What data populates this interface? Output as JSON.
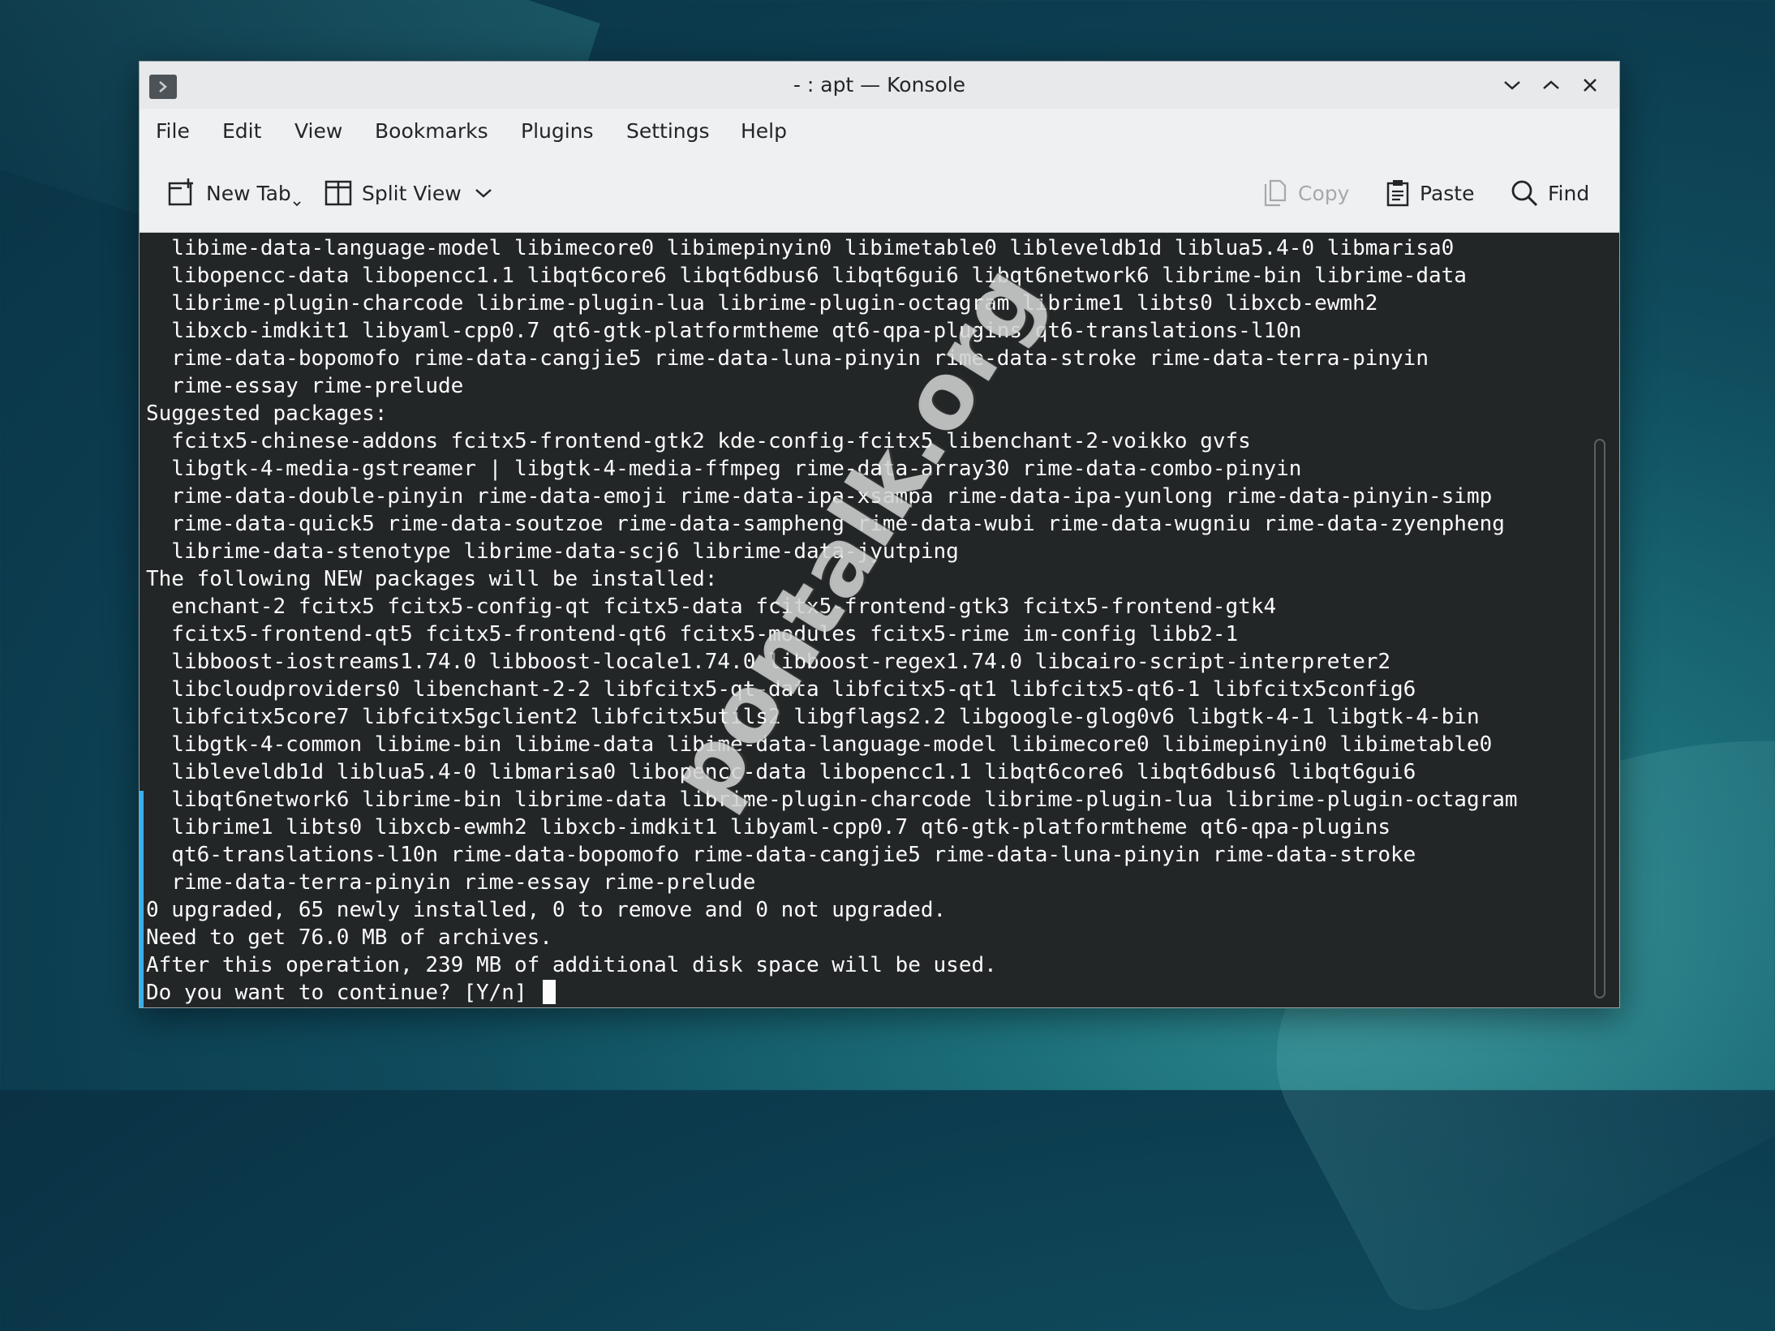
{
  "window": {
    "title": "- : apt — Konsole"
  },
  "menu": [
    "File",
    "Edit",
    "View",
    "Bookmarks",
    "Plugins",
    "Settings",
    "Help"
  ],
  "toolbar": {
    "new_tab": "New Tab",
    "split_view": "Split View",
    "copy": "Copy",
    "paste": "Paste",
    "find": "Find"
  },
  "terminal": {
    "lines": [
      "  libime-data-language-model libimecore0 libimepinyin0 libimetable0 libleveldb1d liblua5.4-0 libmarisa0",
      "  libopencc-data libopencc1.1 libqt6core6 libqt6dbus6 libqt6gui6 libqt6network6 librime-bin librime-data",
      "  librime-plugin-charcode librime-plugin-lua librime-plugin-octagram librime1 libts0 libxcb-ewmh2",
      "  libxcb-imdkit1 libyaml-cpp0.7 qt6-gtk-platformtheme qt6-qpa-plugins qt6-translations-l10n",
      "  rime-data-bopomofo rime-data-cangjie5 rime-data-luna-pinyin rime-data-stroke rime-data-terra-pinyin",
      "  rime-essay rime-prelude",
      "Suggested packages:",
      "  fcitx5-chinese-addons fcitx5-frontend-gtk2 kde-config-fcitx5 libenchant-2-voikko gvfs",
      "  libgtk-4-media-gstreamer | libgtk-4-media-ffmpeg rime-data-array30 rime-data-combo-pinyin",
      "  rime-data-double-pinyin rime-data-emoji rime-data-ipa-xsampa rime-data-ipa-yunlong rime-data-pinyin-simp",
      "  rime-data-quick5 rime-data-soutzoe rime-data-sampheng rime-data-wubi rime-data-wugniu rime-data-zyenpheng",
      "  librime-data-stenotype librime-data-scj6 librime-data-jyutping",
      "The following NEW packages will be installed:",
      "  enchant-2 fcitx5 fcitx5-config-qt fcitx5-data fcitx5-frontend-gtk3 fcitx5-frontend-gtk4",
      "  fcitx5-frontend-qt5 fcitx5-frontend-qt6 fcitx5-modules fcitx5-rime im-config libb2-1",
      "  libboost-iostreams1.74.0 libboost-locale1.74.0 libboost-regex1.74.0 libcairo-script-interpreter2",
      "  libcloudproviders0 libenchant-2-2 libfcitx5-qt-data libfcitx5-qt1 libfcitx5-qt6-1 libfcitx5config6",
      "  libfcitx5core7 libfcitx5gclient2 libfcitx5utils2 libgflags2.2 libgoogle-glog0v6 libgtk-4-1 libgtk-4-bin",
      "  libgtk-4-common libime-bin libime-data libime-data-language-model libimecore0 libimepinyin0 libimetable0",
      "  libleveldb1d liblua5.4-0 libmarisa0 libopencc-data libopencc1.1 libqt6core6 libqt6dbus6 libqt6gui6",
      "  libqt6network6 librime-bin librime-data librime-plugin-charcode librime-plugin-lua librime-plugin-octagram",
      "  librime1 libts0 libxcb-ewmh2 libxcb-imdkit1 libyaml-cpp0.7 qt6-gtk-platformtheme qt6-qpa-plugins",
      "  qt6-translations-l10n rime-data-bopomofo rime-data-cangjie5 rime-data-luna-pinyin rime-data-stroke",
      "  rime-data-terra-pinyin rime-essay rime-prelude",
      "0 upgraded, 65 newly installed, 0 to remove and 0 not upgraded.",
      "Need to get 76.0 MB of archives.",
      "After this operation, 239 MB of additional disk space will be used.",
      "Do you want to continue? [Y/n] "
    ]
  },
  "watermark": "pontalk.org",
  "icons": {
    "app": "konsole-terminal-icon",
    "minimize": "chevron-down-icon",
    "maximize": "chevron-up-icon",
    "close": "close-icon",
    "new_tab": "new-tab-icon",
    "split_view": "split-view-icon",
    "split_view_menu": "chevron-down-icon",
    "copy": "copy-icon",
    "paste": "paste-icon",
    "find": "search-icon"
  },
  "colors": {
    "terminal_bg": "#232627",
    "terminal_fg": "#fcfcfc",
    "chrome_bg": "#eff0f1",
    "accent": "#3daee9"
  }
}
